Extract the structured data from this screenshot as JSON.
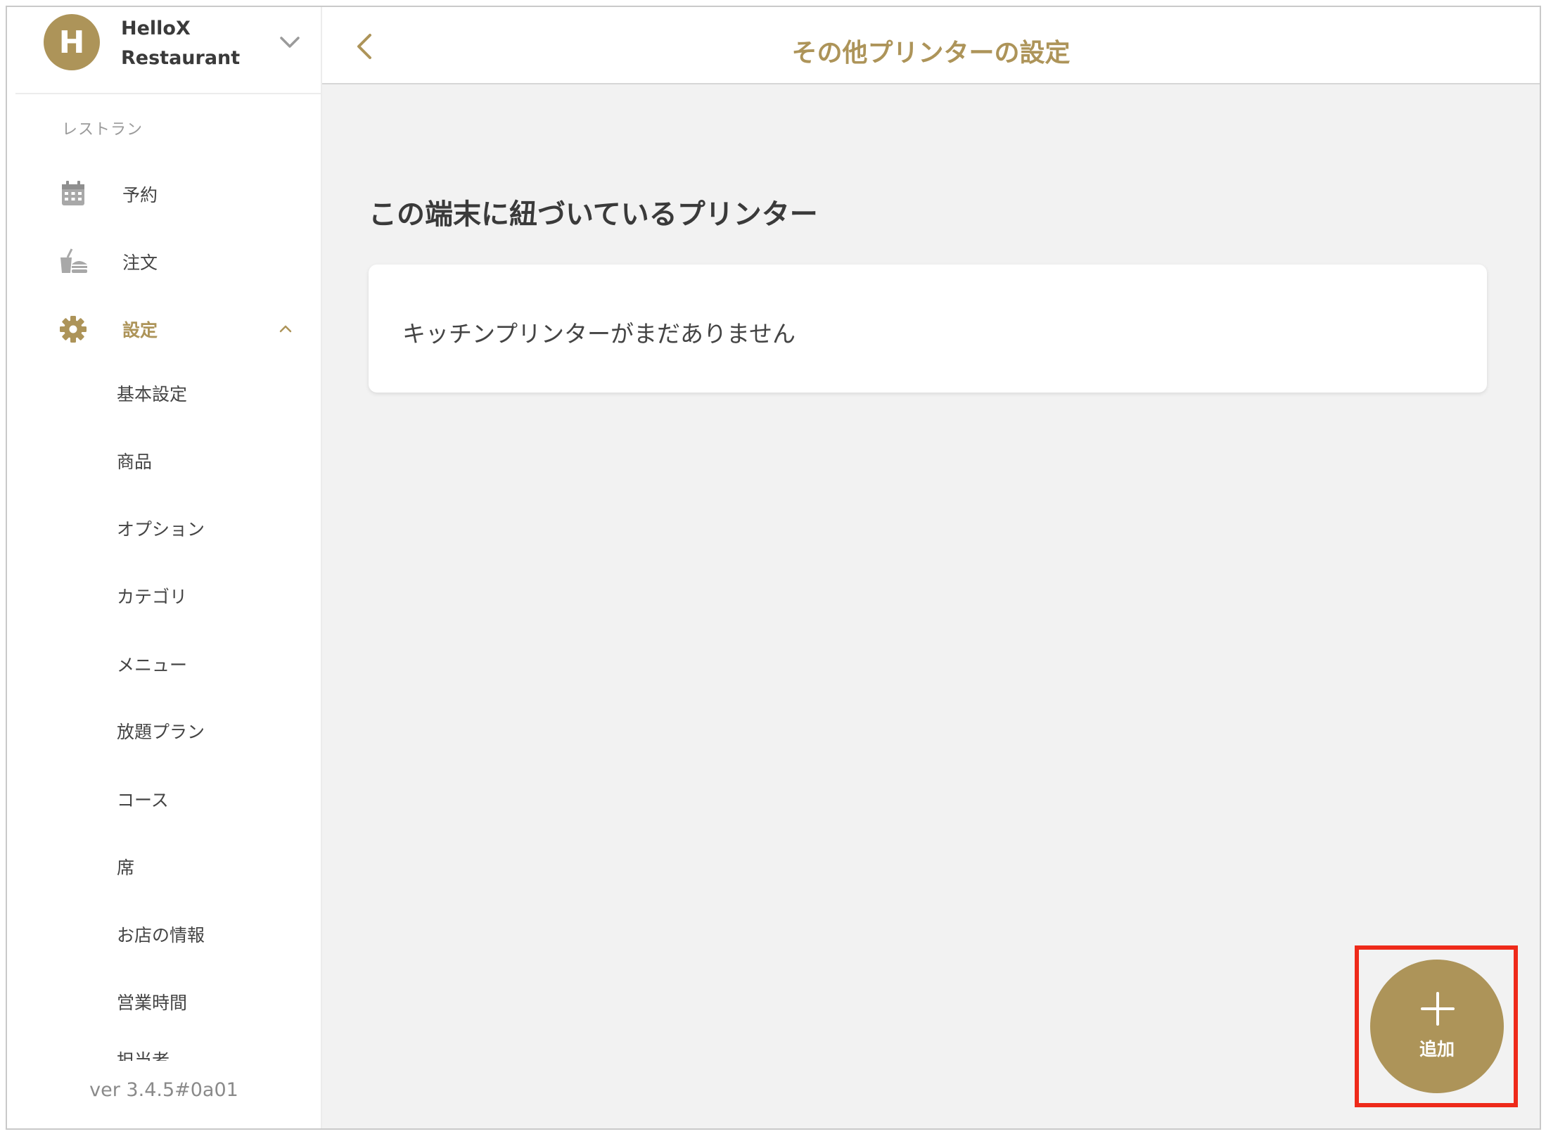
{
  "brand": {
    "initial": "H",
    "name": "HelloX Restaurant"
  },
  "sidebar": {
    "section_label": "レストラン",
    "items": [
      {
        "label": "予約",
        "icon": "calendar-icon"
      },
      {
        "label": "注文",
        "icon": "food-order-icon"
      },
      {
        "label": "設定",
        "icon": "gear-icon",
        "active": true
      }
    ],
    "sub_items": [
      "基本設定",
      "商品",
      "オプション",
      "カテゴリ",
      "メニュー",
      "放題プラン",
      "コース",
      "席",
      "お店の情報",
      "営業時間"
    ],
    "partial_item": "担当者",
    "version": "ver 3.4.5#0a01"
  },
  "header": {
    "title": "その他プリンターの設定"
  },
  "content": {
    "title": "この端末に紐づいているプリンター",
    "empty_message": "キッチンプリンターがまだありません"
  },
  "fab": {
    "label": "追加"
  },
  "colors": {
    "accent": "#ad9459",
    "highlight": "#ee2a1a",
    "background": "#f2f2f2"
  }
}
